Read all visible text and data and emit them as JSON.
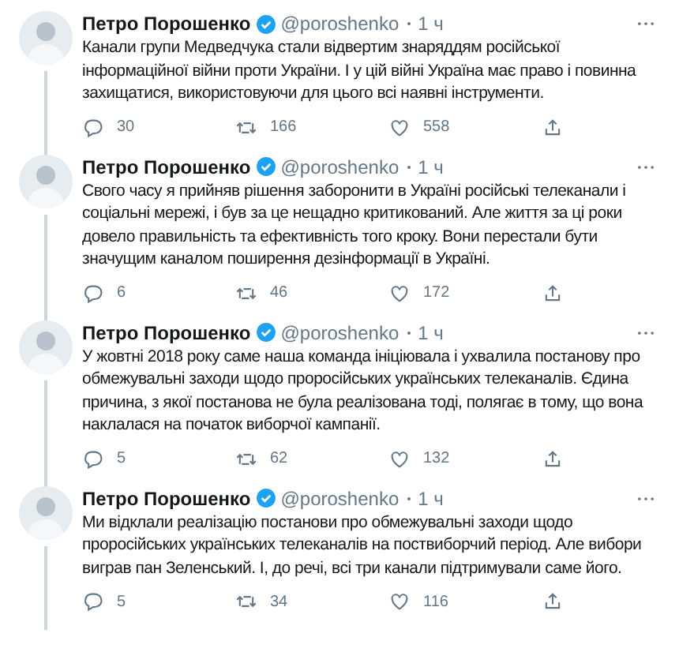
{
  "tweets": [
    {
      "name": "Петро Порошенко",
      "verified": true,
      "handle": "@poroshenko",
      "time": "1 ч",
      "text": "Канали групи Медведчука стали відвертим знаряддям російської інформаційної війни проти України. І у цій війні Україна має право і повинна захищатися, використовуючи для цього всі наявні інструменти.",
      "replies": "30",
      "retweets": "166",
      "likes": "558"
    },
    {
      "name": "Петро Порошенко",
      "verified": true,
      "handle": "@poroshenko",
      "time": "1 ч",
      "text": "Свого часу я прийняв рішення заборонити в Україні російські телеканали і соціальні мережі, і був за це нещадно критикований. Але життя за ці роки довело правильність та ефективність того кроку. Вони перестали бути значущим каналом поширення дезінформації в Україні.",
      "replies": "6",
      "retweets": "46",
      "likes": "172"
    },
    {
      "name": "Петро Порошенко",
      "verified": true,
      "handle": "@poroshenko",
      "time": "1 ч",
      "text": "У жовтні 2018 року саме наша команда ініціювала і ухвалила постанову про обмежувальні заходи щодо проросійських українських телеканалів. Єдина причина, з якої постанова не була реалізована тоді, полягає в тому, що вона наклалася на початок виборчої кампанії.",
      "replies": "5",
      "retweets": "62",
      "likes": "132"
    },
    {
      "name": "Петро Порошенко",
      "verified": true,
      "handle": "@poroshenko",
      "time": "1 ч",
      "text": "Ми відклали реалізацію постанови про обмежувальні заходи щодо проросійських українських телеканалів на поствиборчий період. Але вибори виграв пан Зеленський. І, до речі, всі три канали підтримували саме його.",
      "replies": "5",
      "retweets": "34",
      "likes": "116"
    }
  ]
}
